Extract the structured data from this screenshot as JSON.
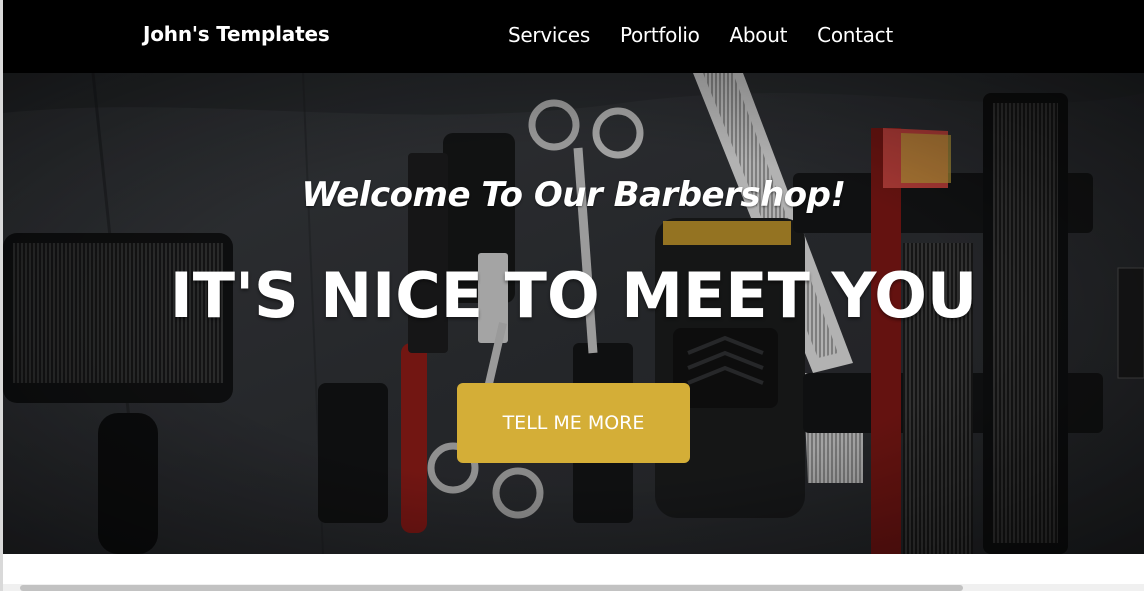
{
  "navbar": {
    "brand": "John's Templates",
    "links": [
      {
        "label": "Services"
      },
      {
        "label": "Portfolio"
      },
      {
        "label": "About"
      },
      {
        "label": "Contact"
      }
    ],
    "background": "#000000"
  },
  "hero": {
    "welcome": "Welcome To Our Barbershop!",
    "headline": "IT'S NICE TO MEET YOU",
    "cta_label": "TELL ME MORE",
    "accent": "#d4ae37",
    "image": "barber-tools-photo"
  }
}
